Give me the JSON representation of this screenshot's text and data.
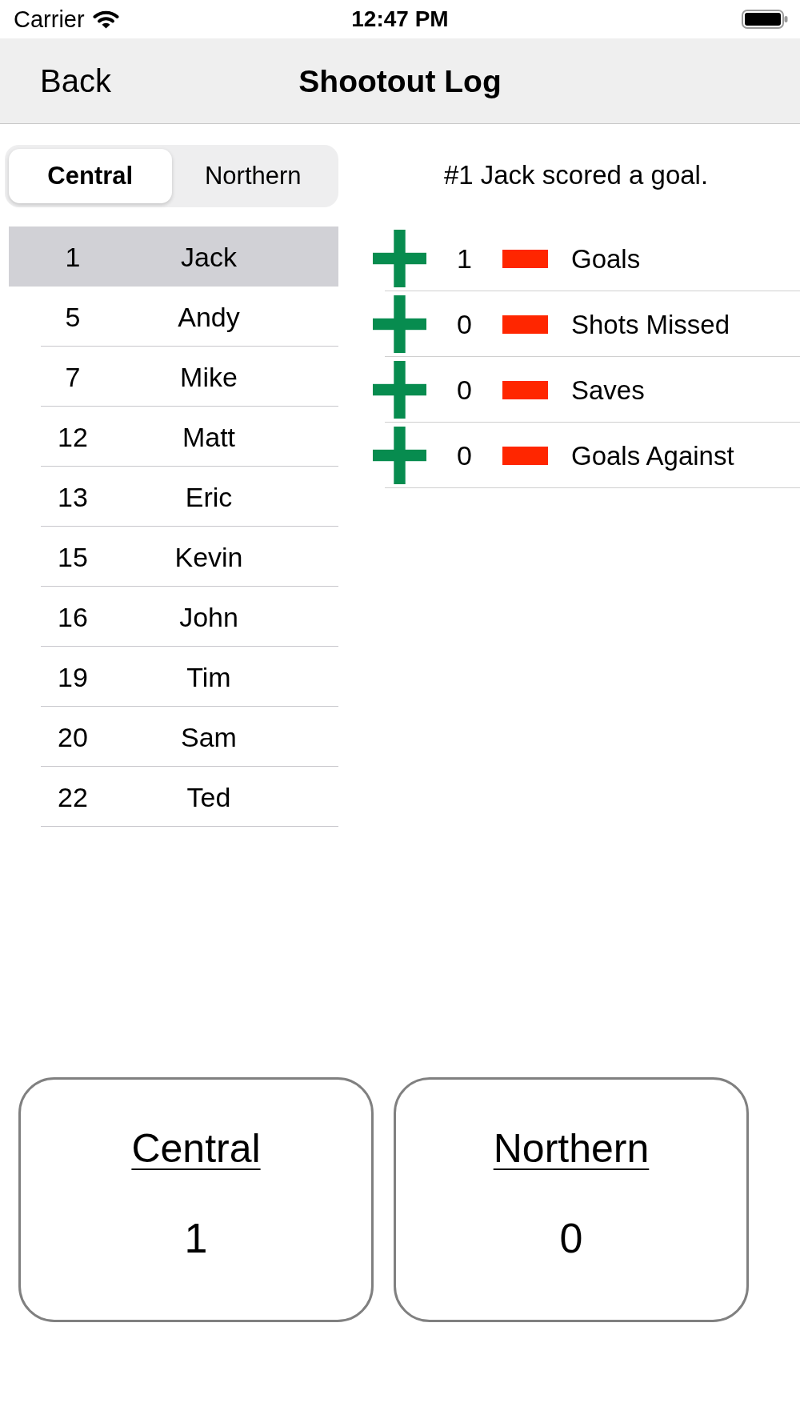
{
  "status_bar": {
    "carrier": "Carrier",
    "time": "12:47 PM"
  },
  "nav_bar": {
    "back": "Back",
    "title": "Shootout Log"
  },
  "team_tabs": [
    {
      "label": "Central",
      "selected": true
    },
    {
      "label": "Northern",
      "selected": false
    }
  ],
  "players": [
    {
      "number": "1",
      "name": "Jack",
      "selected": true
    },
    {
      "number": "5",
      "name": "Andy",
      "selected": false
    },
    {
      "number": "7",
      "name": "Mike",
      "selected": false
    },
    {
      "number": "12",
      "name": "Matt",
      "selected": false
    },
    {
      "number": "13",
      "name": "Eric",
      "selected": false
    },
    {
      "number": "15",
      "name": "Kevin",
      "selected": false
    },
    {
      "number": "16",
      "name": "John",
      "selected": false
    },
    {
      "number": "19",
      "name": "Tim",
      "selected": false
    },
    {
      "number": "20",
      "name": "Sam",
      "selected": false
    },
    {
      "number": "22",
      "name": "Ted",
      "selected": false
    }
  ],
  "message": "#1 Jack scored a goal.",
  "stats": [
    {
      "value": "1",
      "label": "Goals"
    },
    {
      "value": "0",
      "label": "Shots Missed"
    },
    {
      "value": "0",
      "label": "Saves"
    },
    {
      "value": "0",
      "label": "Goals Against"
    }
  ],
  "scores": [
    {
      "team": "Central",
      "score": "1"
    },
    {
      "team": "Northern",
      "score": "0"
    }
  ]
}
